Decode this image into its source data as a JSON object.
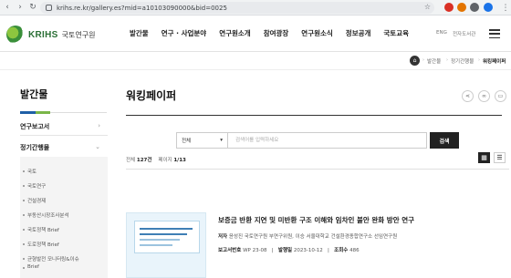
{
  "browser": {
    "url": "krihs.re.kr/gallery.es?mid=a10103090000&bid=0025"
  },
  "header": {
    "logo_en": "KRIHS",
    "logo_ko": "국토연구원",
    "nav": [
      "발간물",
      "연구 · 사업분야",
      "연구원소개",
      "참여광장",
      "연구원소식",
      "정보공개",
      "국토교육"
    ],
    "lang": "ENG",
    "site": "전자도서관"
  },
  "breadcrumb": [
    "발간물",
    "정기간행물",
    "워킹페이퍼"
  ],
  "sidebar": {
    "title": "발간물",
    "categories": [
      "연구보고서",
      "정기간행물"
    ],
    "items": [
      "국토",
      "국토연구",
      "건설경제",
      "부동산시장조사분석",
      "국토정책 Brief",
      "도로정책 Brief",
      "균형발전 모니터링&이슈",
      "Brief"
    ]
  },
  "main": {
    "title": "워킹페이퍼",
    "search": {
      "select": "전체",
      "placeholder": "검색어를 입력하세요",
      "button": "검색"
    },
    "count": {
      "total_label": "전체",
      "total": "127건",
      "page_label": "페이지",
      "page": "1/13"
    },
    "item": {
      "title": "보증금 반환 지연 및 미반환 구조 이해와 임차인 불안 완화 방안 연구",
      "author_label": "저자",
      "author": "윤성진 국토연구원 부연구위원, 이승 서울대학교 건설환경종합연구소 선임연구원",
      "report_no_label": "보고서번호",
      "report_no": "WP 23-08",
      "date_label": "발행일",
      "date": "2023-10-12",
      "views_label": "조회수",
      "views": "486"
    }
  },
  "colors": {
    "brand_green": "#2a6f35",
    "accent_blue": "#1f5fa6",
    "accent_light_green": "#7ab648",
    "button_dark": "#222222"
  }
}
